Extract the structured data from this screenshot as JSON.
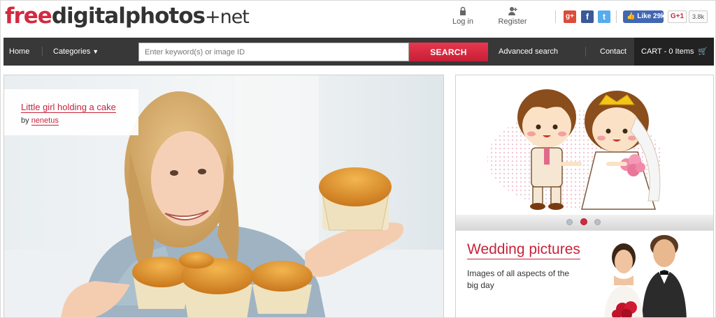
{
  "logo": {
    "part1": "free",
    "part2": "digitalphotos",
    "part3": "+",
    "part4": "net"
  },
  "account": {
    "login_label": "Log in",
    "register_label": "Register"
  },
  "social": {
    "gplus_label": "g+",
    "facebook_label": "f",
    "twitter_label": "t",
    "fb_like_label": "Like 29k",
    "gplus_one_label": "G+1",
    "gplus_count": "3.8k"
  },
  "nav": {
    "home_label": "Home",
    "categories_label": "Categories",
    "search_placeholder": "Enter keyword(s) or image ID",
    "search_button_label": "SEARCH",
    "advanced_search_label": "Advanced search",
    "contact_label": "Contact",
    "cart_label": "CART - 0 Items"
  },
  "hero": {
    "caption_title": "Little girl holding a cake",
    "caption_by": "by",
    "caption_author": "nenetus"
  },
  "side": {
    "slide_index": 2,
    "slide_count": 3,
    "promo_title": "Wedding pictures",
    "promo_description": "Images of all aspects of the big day"
  },
  "colors": {
    "brand_red": "#d12a41",
    "nav_dark": "#383838",
    "cart_dark": "#222222"
  }
}
